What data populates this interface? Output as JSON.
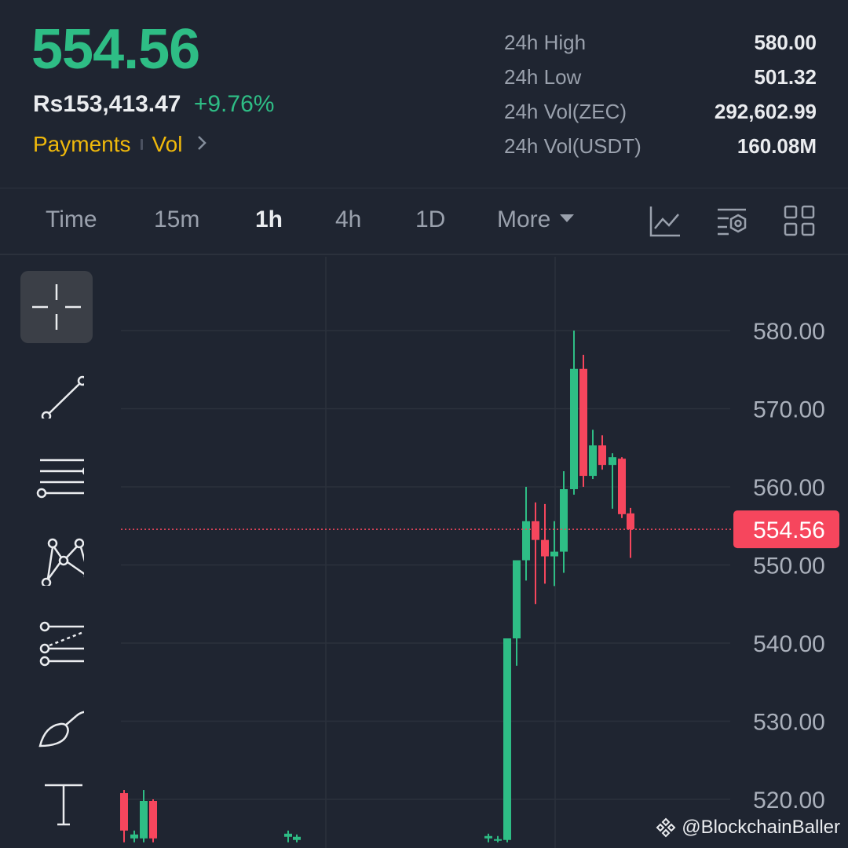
{
  "header": {
    "price": "554.56",
    "fiat_price": "Rs153,413.47",
    "change_pct": "+9.76%",
    "tags": [
      "Payments",
      "Vol"
    ],
    "stats": [
      {
        "label": "24h High",
        "value": "580.00"
      },
      {
        "label": "24h Low",
        "value": "501.32"
      },
      {
        "label": "24h Vol(ZEC)",
        "value": "292,602.99"
      },
      {
        "label": "24h Vol(USDT)",
        "value": "160.08M"
      }
    ]
  },
  "timeframes": {
    "time": "Time",
    "m15": "15m",
    "h1": "1h",
    "h4": "4h",
    "d1": "1D",
    "more": "More",
    "active": "1h"
  },
  "toolbar_icons": [
    "line-chart-icon",
    "indicator-settings-icon",
    "layout-grid-icon"
  ],
  "drawing_tools": [
    "crosshair-icon",
    "trend-line-icon",
    "horizontal-lines-icon",
    "pattern-icon",
    "fibonacci-icon",
    "brush-icon",
    "text-icon"
  ],
  "colors": {
    "up": "#2ebd85",
    "down": "#f6465d",
    "bg": "#1f2531",
    "accent": "#f0b90b"
  },
  "watermark": "@BlockchainBaller",
  "chart_data": {
    "type": "candlestick",
    "y_ticks": [
      "580.00",
      "570.00",
      "560.00",
      "550.00",
      "540.00",
      "530.00",
      "520.00"
    ],
    "ylim": [
      514.5,
      585.8
    ],
    "last_price": 554.56,
    "last_price_label": "554.56",
    "candles": [
      {
        "o": 520.8,
        "h": 521.2,
        "l": 514.5,
        "c": 516.0
      },
      {
        "o": 515.0,
        "h": 516.0,
        "l": 514.5,
        "c": 515.5
      },
      {
        "o": 515.0,
        "h": 521.2,
        "l": 514.5,
        "c": 519.8
      },
      {
        "o": 519.8,
        "h": 520.0,
        "l": 514.5,
        "c": 515.0
      },
      {
        "o": 515.2,
        "h": 516.0,
        "l": 514.5,
        "c": 515.6
      },
      {
        "o": 514.8,
        "h": 515.5,
        "l": 514.5,
        "c": 515.2
      },
      {
        "o": 515.0,
        "h": 515.6,
        "l": 514.5,
        "c": 515.3
      },
      {
        "o": 514.8,
        "h": 515.3,
        "l": 514.5,
        "c": 514.9
      },
      {
        "o": 514.8,
        "h": 520.6,
        "l": 514.5,
        "c": 540.6
      },
      {
        "o": 540.6,
        "h": 544.4,
        "l": 537.1,
        "c": 550.6
      },
      {
        "o": 550.6,
        "h": 560.0,
        "l": 548.0,
        "c": 555.6
      },
      {
        "o": 555.6,
        "h": 558.0,
        "l": 545.0,
        "c": 553.2
      },
      {
        "o": 553.2,
        "h": 557.8,
        "l": 547.6,
        "c": 551.1
      },
      {
        "o": 551.1,
        "h": 555.6,
        "l": 547.3,
        "c": 551.7
      },
      {
        "o": 551.7,
        "h": 562.0,
        "l": 549.0,
        "c": 559.7
      },
      {
        "o": 559.7,
        "h": 580.0,
        "l": 559.0,
        "c": 575.1
      },
      {
        "o": 575.1,
        "h": 576.9,
        "l": 560.0,
        "c": 561.4
      },
      {
        "o": 561.4,
        "h": 567.3,
        "l": 561.0,
        "c": 565.3
      },
      {
        "o": 565.3,
        "h": 566.6,
        "l": 562.2,
        "c": 562.8
      },
      {
        "o": 562.8,
        "h": 564.3,
        "l": 557.2,
        "c": 563.8
      },
      {
        "o": 563.6,
        "h": 563.8,
        "l": 556.0,
        "c": 556.5
      },
      {
        "o": 556.6,
        "h": 557.3,
        "l": 550.9,
        "c": 554.56
      }
    ]
  }
}
